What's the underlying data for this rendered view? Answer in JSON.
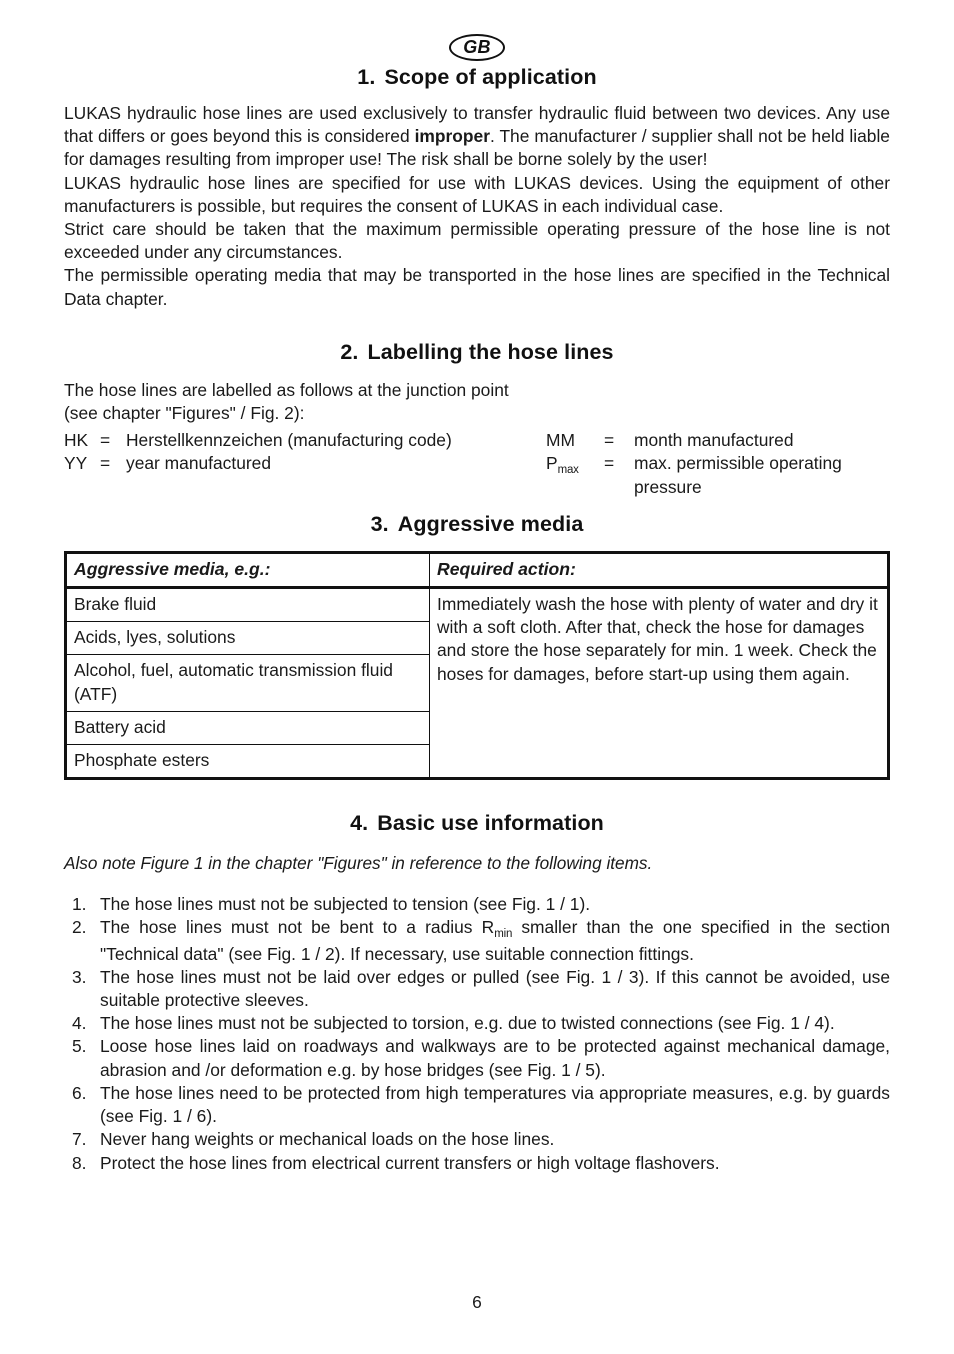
{
  "badge": {
    "label": "GB"
  },
  "sections": {
    "scope": {
      "number": "1.",
      "title": "Scope of application",
      "paragraphs": [
        {
          "pre": "LUKAS hydraulic hose lines are used exclusively to transfer hydraulic fluid between two devices. Any use that differs or goes beyond this is considered ",
          "strong": "improper",
          "post": ". The manufacturer / supplier shall not be held liable for damages resulting from improper use! The risk shall be borne solely by the user!"
        },
        {
          "text": "LUKAS hydraulic hose lines are specified for use with LUKAS devices. Using the equipment of other manufacturers is possible, but requires the consent of LUKAS in each individual case."
        },
        {
          "text": "Strict care should be taken that the maximum permissible operating pressure of the hose line is not exceeded under any circumstances."
        },
        {
          "text": "The permissible operating media that may be transported in the hose lines are specified in the Technical Data chapter."
        }
      ]
    },
    "labelling": {
      "number": "2.",
      "title": "Labelling the hose lines",
      "intro_line1": "The hose lines are labelled as follows at the junction point",
      "intro_line2": "(see chapter \"Figures\" / Fig. 2):",
      "key": {
        "left": [
          {
            "abbr": "HK",
            "eq": "=",
            "meaning": "Herstellkennzeichen (manufacturing code)"
          },
          {
            "abbr": "YY",
            "eq": "=",
            "meaning": "year manufactured"
          }
        ],
        "right": [
          {
            "abbr": "MM",
            "sub": "",
            "eq": "=",
            "meaning": "month manufactured"
          },
          {
            "abbr": "P",
            "sub": "max",
            "eq": "=",
            "meaning": "max. permissible operating pressure"
          }
        ]
      }
    },
    "aggressive": {
      "number": "3.",
      "title": "Aggressive media",
      "table": {
        "headers": [
          "Aggressive media, e.g.:",
          "Required action:"
        ],
        "media": [
          "Brake fluid",
          "Acids, lyes, solutions",
          "Alcohol, fuel, automatic transmission fluid (ATF)",
          "Battery acid",
          "Phosphate esters"
        ],
        "action": "Immediately wash the hose with plenty of water and dry it with a soft cloth. After that, check the hose for damages and store the hose separately for min. 1 week. Check the hoses for damages, before start-up using them again."
      }
    },
    "basic_use": {
      "number": "4.",
      "title": "Basic use information",
      "note": "Also note Figure 1 in the chapter \"Figures\" in reference to the following items.",
      "items": [
        {
          "num": "1.",
          "text": "The hose lines must not be subjected to tension (see Fig. 1 / 1)."
        },
        {
          "num": "2.",
          "pre": "The hose lines must not be bent to a radius R",
          "sub": "min",
          "post": " smaller than the one specified in the section \"Technical data\" (see Fig. 1 / 2). If necessary, use suitable connection fittings."
        },
        {
          "num": "3.",
          "text": "The hose lines must not be laid over edges or pulled (see Fig. 1 / 3). If this cannot be avoided, use suitable protective sleeves."
        },
        {
          "num": "4.",
          "text": "The hose lines must not be subjected to torsion, e.g. due to twisted connections (see Fig. 1 / 4)."
        },
        {
          "num": "5.",
          "text": "Loose hose lines laid on roadways and walkways are to be protected against mechanical damage, abrasion and /or deformation e.g. by hose bridges (see Fig. 1 / 5)."
        },
        {
          "num": "6.",
          "text": "The hose lines need to be protected from high temperatures via appropriate measures, e.g. by guards (see Fig. 1 / 6)."
        },
        {
          "num": "7.",
          "text": "Never hang weights or mechanical loads on the hose lines."
        },
        {
          "num": "8.",
          "text": "Protect the hose lines from electrical current transfers or high voltage flashovers."
        }
      ]
    }
  },
  "footer": {
    "page_number": "6"
  },
  "colors": {
    "text": "#1a1a1a",
    "rule": "#111111",
    "background": "#ffffff"
  }
}
